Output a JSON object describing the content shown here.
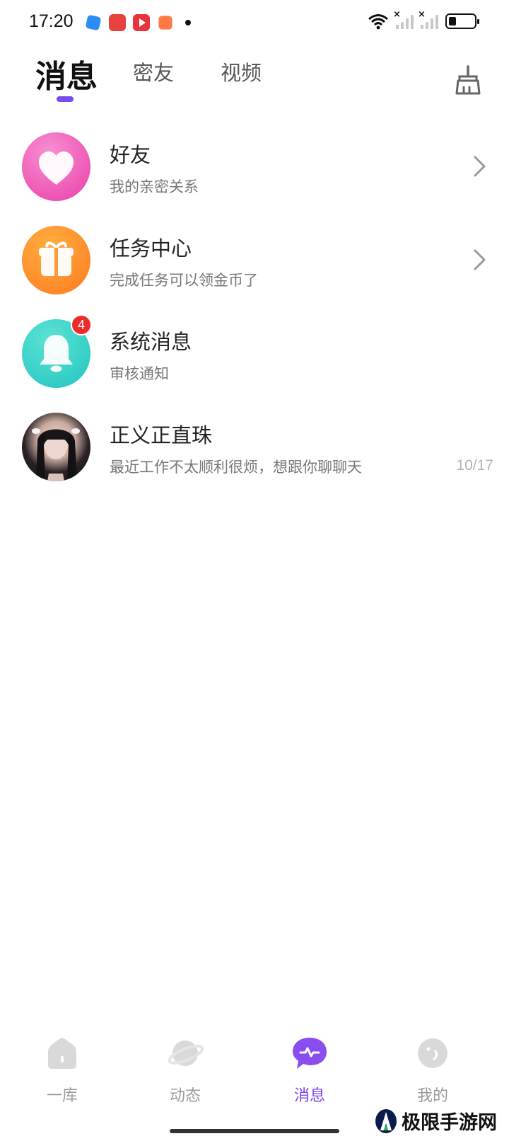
{
  "status_bar": {
    "time": "17:20",
    "battery_level": 0.3
  },
  "top_tabs": {
    "items": [
      {
        "label": "消息",
        "active": true
      },
      {
        "label": "密友",
        "active": false
      },
      {
        "label": "视频",
        "active": false
      }
    ],
    "clear_icon": "broom-icon"
  },
  "messages": [
    {
      "title": "好友",
      "subtitle": "我的亲密关系",
      "icon": "heart-icon",
      "has_arrow": true
    },
    {
      "title": "任务中心",
      "subtitle": "完成任务可以领金币了",
      "icon": "gift-icon",
      "has_arrow": true
    },
    {
      "title": "系统消息",
      "subtitle": "审核通知",
      "icon": "bell-icon",
      "badge": "4"
    },
    {
      "title": "正义正直珠",
      "subtitle": "最近工作不太顺利很烦，想跟你聊聊天",
      "time": "10/17"
    }
  ],
  "bottom_nav": {
    "items": [
      {
        "label": "一库",
        "icon": "home-icon",
        "active": false
      },
      {
        "label": "动态",
        "icon": "planet-icon",
        "active": false
      },
      {
        "label": "消息",
        "icon": "chat-icon",
        "active": true
      },
      {
        "label": "我的",
        "icon": "face-icon",
        "active": false
      }
    ]
  },
  "watermark": {
    "text": "极限手游网"
  },
  "colors": {
    "accent": "#7a44e6",
    "badge": "#ee2b2b"
  }
}
